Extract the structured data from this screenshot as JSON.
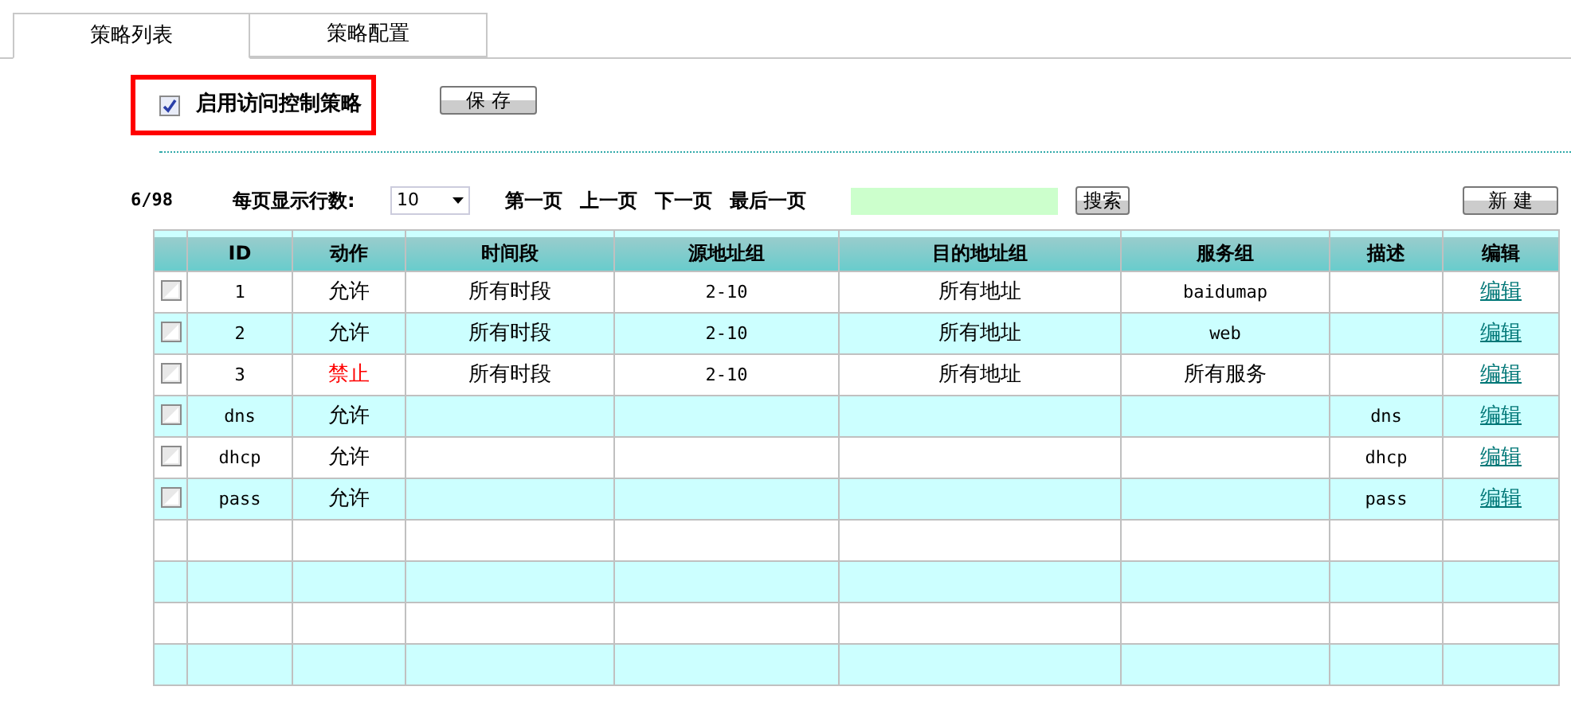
{
  "tabs": [
    {
      "label": "策略列表",
      "selected": true
    },
    {
      "label": "策略配置",
      "selected": false
    }
  ],
  "enable": {
    "label": "启用访问控制策略",
    "checked": true
  },
  "save_button": "保 存",
  "toolbar": {
    "count": "6/98",
    "rows_per_page_label": "每页显示行数:",
    "rows_per_page": "10",
    "pager": [
      "第一页",
      "上一页",
      "下一页",
      "最后一页"
    ],
    "search_button": "搜索",
    "new_button": "新 建"
  },
  "table": {
    "columns": [
      "ID",
      "动作",
      "时间段",
      "源地址组",
      "目的地址组",
      "服务组",
      "描述",
      "编辑"
    ],
    "rows": [
      {
        "checked": false,
        "id": "1",
        "action": {
          "text": "允许",
          "color": "#000000"
        },
        "time": "所有时段",
        "source": "2-10",
        "destination": "所有地址",
        "service": "baidumap",
        "description": "",
        "edit": "编辑"
      },
      {
        "checked": false,
        "id": "2",
        "action": {
          "text": "允许",
          "color": "#000000"
        },
        "time": "所有时段",
        "source": "2-10",
        "destination": "所有地址",
        "service": "web",
        "description": "",
        "edit": "编辑"
      },
      {
        "checked": false,
        "id": "3",
        "action": {
          "text": "禁止",
          "color": "#ff0000"
        },
        "time": "所有时段",
        "source": "2-10",
        "destination": "所有地址",
        "service": "所有服务",
        "description": "",
        "edit": "编辑"
      },
      {
        "checked": false,
        "id": "dns",
        "action": {
          "text": "允许",
          "color": "#000000"
        },
        "time": "",
        "source": "",
        "destination": "",
        "service": "",
        "description": "dns",
        "edit": "编辑"
      },
      {
        "checked": false,
        "id": "dhcp",
        "action": {
          "text": "允许",
          "color": "#000000"
        },
        "time": "",
        "source": "",
        "destination": "",
        "service": "",
        "description": "dhcp",
        "edit": "编辑"
      },
      {
        "checked": false,
        "id": "pass",
        "action": {
          "text": "允许",
          "color": "#000000"
        },
        "time": "",
        "source": "",
        "destination": "",
        "service": "",
        "description": "pass",
        "edit": "编辑"
      }
    ]
  }
}
